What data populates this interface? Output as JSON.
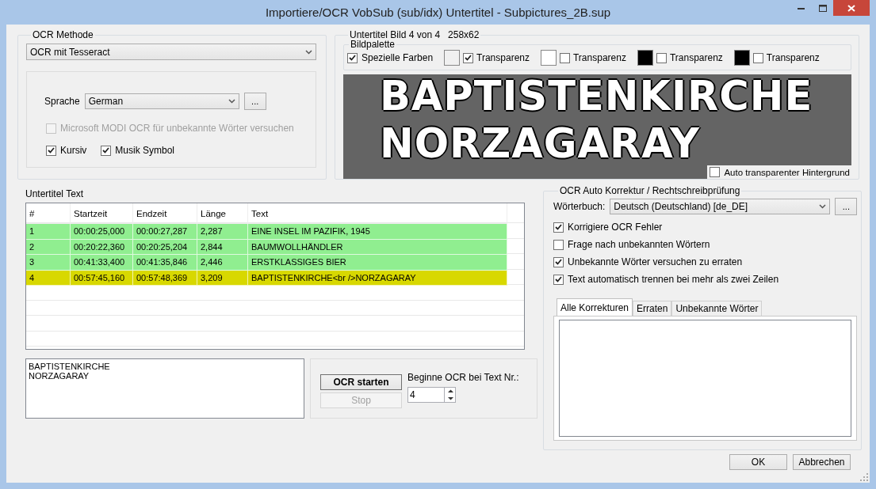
{
  "window": {
    "title": "Importiere/OCR VobSub (sub/idx) Untertitel - Subpictures_2B.sup"
  },
  "ocr_method": {
    "title": "OCR Methode",
    "engine": "OCR mit Tesseract",
    "language_label": "Sprache",
    "language": "German",
    "language_more": "...",
    "modi": {
      "label": "Microsoft MODI OCR für unbekannte Wörter versuchen",
      "checked": false,
      "disabled": true
    },
    "options": [
      {
        "label": "Kursiv",
        "checked": true
      },
      {
        "label": "Musik Symbol",
        "checked": true
      }
    ]
  },
  "image": {
    "title": "Untertitel Bild 4 von 4",
    "size": "258x62",
    "palette_title": "Bildpalette",
    "special_colors": {
      "label": "Spezielle Farben",
      "checked": true
    },
    "palette": [
      {
        "color": "#f0f0f0",
        "label": "Transparenz",
        "checked": true
      },
      {
        "color": "#ffffff",
        "label": "Transparenz",
        "checked": false
      },
      {
        "color": "#000000",
        "label": "Transparenz",
        "checked": false
      },
      {
        "color": "#000000",
        "label": "Transparenz",
        "checked": false
      }
    ],
    "lines": [
      "BAPTISTENKIRCHE",
      "NORZAGARAY"
    ],
    "auto_transparent": {
      "label": "Auto transparenter Hintergrund",
      "checked": false
    }
  },
  "subtitles": {
    "title": "Untertitel Text",
    "columns": [
      "#",
      "Startzeit",
      "Endzeit",
      "Länge",
      "Text"
    ],
    "rows": [
      {
        "cells": [
          "1",
          "00:00:25,000",
          "00:00:27,287",
          "2,287",
          "EINE INSEL IM PAZIFIK, 1945"
        ],
        "color": "#90ee90",
        "selected": false
      },
      {
        "cells": [
          "2",
          "00:20:22,360",
          "00:20:25,204",
          "2,844",
          "BAUMWOLLHÄNDLER"
        ],
        "color": "#90ee90",
        "selected": false
      },
      {
        "cells": [
          "3",
          "00:41:33,400",
          "00:41:35,846",
          "2,446",
          "ERSTKLASSIGES BIER"
        ],
        "color": "#90ee90",
        "selected": false
      },
      {
        "cells": [
          "4",
          "00:57:45,160",
          "00:57:48,369",
          "3,209",
          "BAPTISTENKIRCHE<br />NORZAGARAY"
        ],
        "selected": true
      }
    ]
  },
  "current_text": [
    "BAPTISTENKIRCHE",
    "NORZAGARAY"
  ],
  "ocr_controls": {
    "start": "OCR starten",
    "stop": {
      "label": "Stop",
      "disabled": true
    },
    "start_label": "Beginne OCR bei Text Nr.:",
    "start_value": "4"
  },
  "correction": {
    "title": "OCR Auto Korrektur / Rechtschreibprüfung",
    "dictionary_label": "Wörterbuch:",
    "dictionary": "Deutsch (Deutschland) [de_DE]",
    "dictionary_more": "...",
    "options": [
      {
        "label": "Korrigiere OCR Fehler",
        "checked": true
      },
      {
        "label": "Frage nach unbekannten Wörtern",
        "checked": false
      },
      {
        "label": "Unbekannte Wörter versuchen zu erraten",
        "checked": true
      },
      {
        "label": "Text automatisch trennen bei mehr als zwei Zeilen",
        "checked": true
      }
    ],
    "tabs": [
      {
        "label": "Alle Korrekturen",
        "selected": true
      },
      {
        "label": "Erraten",
        "selected": false
      },
      {
        "label": "Unbekannte Wörter",
        "selected": false
      }
    ]
  },
  "buttons": [
    {
      "label": "OK"
    },
    {
      "label": "Abbrechen"
    }
  ]
}
